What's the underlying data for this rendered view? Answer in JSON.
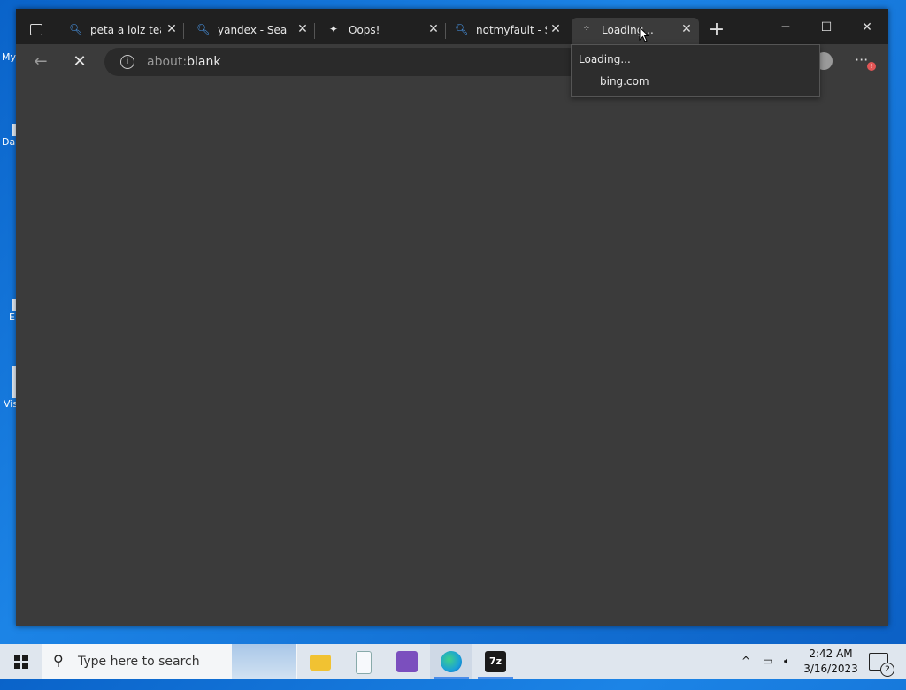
{
  "desktop": {
    "icons": [
      {
        "label": "My"
      },
      {
        "label": "Da"
      },
      {
        "label": "E"
      },
      {
        "label": "Vis"
      }
    ]
  },
  "browser": {
    "tabs": [
      {
        "title": "peta a lolz tean",
        "icon": "search-icon"
      },
      {
        "title": "yandex - Searcl",
        "icon": "search-icon"
      },
      {
        "title": "Oops!",
        "icon": "sparkle-icon"
      },
      {
        "title": "notmyfault - Se",
        "icon": "search-icon"
      },
      {
        "title": "Loading...",
        "icon": "loading-spinner-icon"
      }
    ],
    "address": {
      "prefix": "about:",
      "host": "blank"
    },
    "tooltip": {
      "title": "Loading...",
      "domain": "bing.com"
    },
    "menu_badge": "!"
  },
  "taskbar": {
    "search_placeholder": "Type here to search",
    "apps": [
      {
        "name": "file-explorer",
        "color": "#f1c232"
      },
      {
        "name": "notepad",
        "color": "#e9eef5"
      },
      {
        "name": "visual-studio",
        "color": "#7b4fbe"
      },
      {
        "name": "edge",
        "color": "#1aa0d8"
      },
      {
        "name": "7zip",
        "color": "#1a1a1a"
      }
    ],
    "time": "2:42 AM",
    "date": "3/16/2023",
    "notification_count": "2"
  }
}
